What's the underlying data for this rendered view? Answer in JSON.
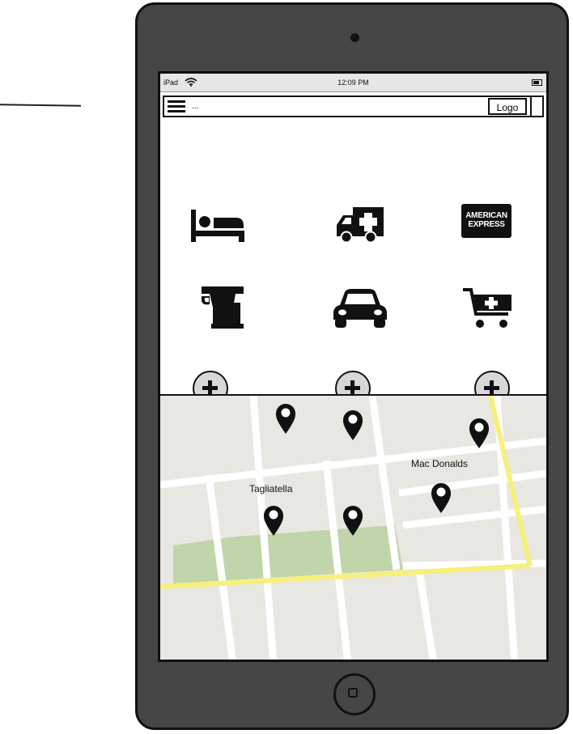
{
  "statusbar": {
    "carrier": "iPad",
    "time": "12:09 PM"
  },
  "toolbar": {
    "search_value": "...",
    "logo_label": "Logo"
  },
  "icons": [
    "bed-icon",
    "ambulance-icon",
    "american-express-icon",
    "coffee-icon",
    "car-icon",
    "add-to-cart-icon",
    "add-button-icon"
  ],
  "amex": {
    "line1": "AMERICAN",
    "line2": "EXPRESS"
  },
  "map": {
    "labels": {
      "mac_donalds": "Mac Donalds",
      "tagliatella": "Tagliatella"
    },
    "colors": {
      "background": "#e9e7e1",
      "roads": "#ffffff",
      "highway": "#f7f07a",
      "park": "#c0d5a9"
    }
  }
}
